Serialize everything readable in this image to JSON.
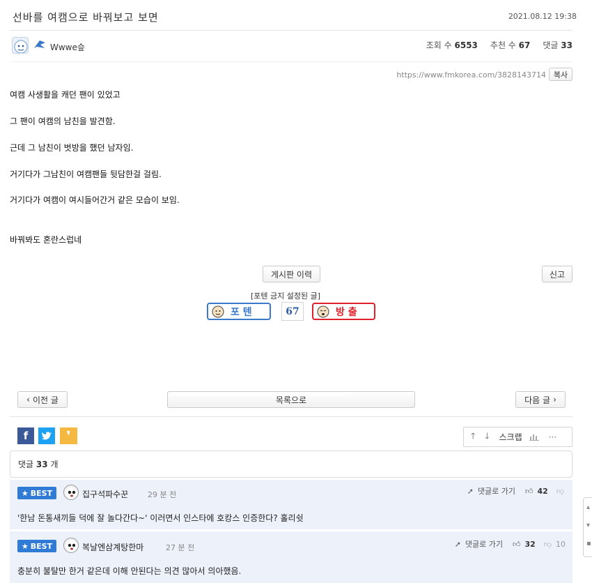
{
  "post": {
    "title": "선바를 여캠으로 바꿔보고 보면",
    "date": "2021.08.12 19:38",
    "author": "Wwwe슾",
    "views_label": "조회 수",
    "views": "6553",
    "recommend_label": "추천 수",
    "recommend": "67",
    "comments_label": "댓글",
    "comments": "33",
    "url": "https://www.fmkorea.com/3828143714",
    "copy_label": "복사",
    "lines": [
      "여캠 사생활을 캐던 팬이 있었고",
      "그 팬이 여캠의 남친을 발견함.",
      "근데 그 남친이 벗방을 했던 남자임.",
      "거기다가 그남친이 여캠팬들 뒷담한걸 걸림.",
      "거기다가 여캠이 여시들어간거 같은 모습이 보임.",
      "바꿔봐도 혼란스럽네"
    ]
  },
  "actions": {
    "history_label": "게시판 이력",
    "report_label": "신고",
    "note": "[포텐 금지 설정된 글]",
    "poten_label": "포 텐",
    "vote_count": "67",
    "ban_label": "방 출"
  },
  "nav": {
    "prev_label": "이전 글",
    "list_label": "목록으로",
    "next_label": "다음 글"
  },
  "share": {
    "facebook": "f",
    "scrap_label": "스크랩",
    "more_label": "···"
  },
  "comments_header": {
    "label": "댓글",
    "count": "33",
    "unit": "개"
  },
  "comments": [
    {
      "badge": "BEST",
      "name": "집구석파수꾼",
      "time": "29 분 전",
      "reply_label": "댓글로 가기",
      "likes": "42",
      "dislikes": "",
      "text": "'한남 돈통새끼들 덕에 잘 놀다간다~' 이러면서 인스타에 호캉스 인증한다? 홀리쉿"
    },
    {
      "badge": "BEST",
      "name": "복날엔삼계탕한마",
      "time": "27 분 전",
      "reply_label": "댓글로 가기",
      "likes": "32",
      "dislikes": "10",
      "text": "충분히 불탈만 한거 같은데 이해 안된다는 의견 많아서 의아했음."
    }
  ],
  "colors": {
    "best": "#2f7bd6",
    "poten_border": "#3a78c9",
    "ban_border": "#e0202a",
    "ban_text": "#e0202a",
    "facebook": "#3b5998",
    "twitter": "#1da1f2",
    "quote": "#f5b942",
    "comment_bg": "#edf2fa"
  }
}
